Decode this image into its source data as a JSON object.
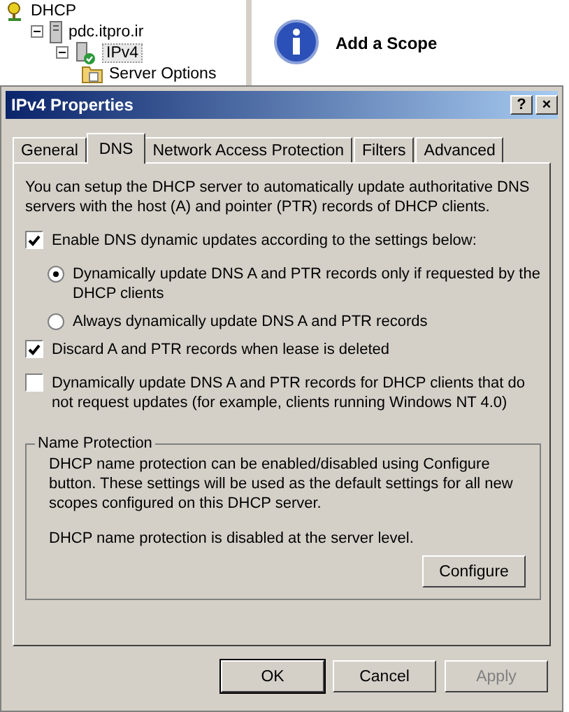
{
  "tree": [
    {
      "label": "DHCP",
      "kind": "dhcp",
      "children": [
        {
          "label": "pdc.itpro.ir",
          "kind": "server",
          "expanded": true,
          "children": [
            {
              "label": "IPv4",
              "kind": "ipv4",
              "expanded": true,
              "selected": true,
              "children": [
                {
                  "label": "Server Options",
                  "kind": "folder"
                }
              ]
            }
          ]
        }
      ]
    }
  ],
  "info": {
    "title": "Add a Scope"
  },
  "dialog": {
    "title": "IPv4 Properties",
    "help": "?",
    "close": "×",
    "tabs": [
      {
        "label": "General",
        "selected": false
      },
      {
        "label": "DNS",
        "selected": true
      },
      {
        "label": "Network Access Protection",
        "selected": false
      },
      {
        "label": "Filters",
        "selected": false
      },
      {
        "label": "Advanced",
        "selected": false
      }
    ],
    "intro": "You can setup the DHCP server to automatically update authoritative DNS servers with the host (A) and pointer (PTR) records of DHCP clients.",
    "options": [
      {
        "kind": "checkbox",
        "label": "Enable DNS dynamic updates according to the settings below:",
        "checked": true
      },
      {
        "kind": "radio",
        "label": "Dynamically update DNS A and PTR records only if requested by the DHCP clients",
        "selected": true
      },
      {
        "kind": "radio",
        "label": "Always dynamically update DNS A and PTR records",
        "selected": false
      },
      {
        "kind": "checkbox",
        "label": "Discard A and PTR records when lease is deleted",
        "checked": true
      },
      {
        "kind": "checkbox",
        "label": "Dynamically update DNS A and PTR records for DHCP clients that do not request updates (for example, clients running Windows NT 4.0)",
        "checked": false
      }
    ],
    "name_protection": {
      "legend": "Name Protection",
      "text": "DHCP name protection can be enabled/disabled using Configure button. These settings will be used as the default settings for all new scopes configured on this DHCP server.",
      "status": "DHCP name protection is disabled at the server level.",
      "button": "Configure"
    },
    "buttons": [
      {
        "label": "OK",
        "default": true,
        "disabled": false
      },
      {
        "label": "Cancel",
        "default": false,
        "disabled": false
      },
      {
        "label": "Apply",
        "default": false,
        "disabled": true
      }
    ]
  }
}
